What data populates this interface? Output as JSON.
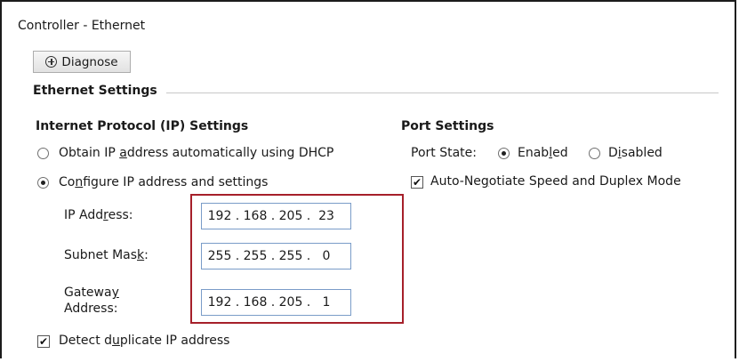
{
  "window": {
    "title": "Controller - Ethernet"
  },
  "toolbar": {
    "diagnose_label": "Diagnose"
  },
  "ethernet_settings": {
    "title": "Ethernet Settings",
    "ip_settings": {
      "title": "Internet Protocol (IP) Settings",
      "dhcp_option": {
        "label_pre": "Obtain IP ",
        "label_ul": "a",
        "label_post": "ddress automatically using DHCP",
        "checked": false
      },
      "manual_option": {
        "label_pre": "Co",
        "label_ul": "n",
        "label_post": "figure IP address and settings",
        "checked": true
      },
      "ip_address": {
        "label_pre": "IP Add",
        "label_ul": "r",
        "label_post": "ess:",
        "octets": [
          "192",
          "168",
          "205",
          "23"
        ]
      },
      "subnet_mask": {
        "label_pre": "Subnet Mas",
        "label_ul": "k",
        "label_post": ":",
        "octets": [
          "255",
          "255",
          "255",
          "0"
        ]
      },
      "gateway": {
        "label_line1_pre": "Gatewa",
        "label_line1_ul": "y",
        "label_line2": "Address:",
        "octets": [
          "192",
          "168",
          "205",
          "1"
        ]
      },
      "detect_duplicate": {
        "label_pre": "Detect d",
        "label_ul": "u",
        "label_post": "plicate IP address",
        "checked": true
      }
    },
    "port_settings": {
      "title": "Port Settings",
      "port_state_label": "Port State:",
      "enabled": {
        "label_pre": "Enab",
        "label_ul": "l",
        "label_post": "ed",
        "checked": true
      },
      "disabled": {
        "label_pre": "D",
        "label_ul": "i",
        "label_post": "sabled",
        "checked": false
      },
      "auto_negotiate": {
        "label_pre": "Auto-Ne",
        "label_ul": "g",
        "label_post": "otiate Speed and Duplex Mode",
        "checked": true
      }
    }
  },
  "colors": {
    "highlight_border": "#a6202a",
    "input_border": "#7a9cc8",
    "group_line": "#c8c8c8"
  },
  "icons": {
    "diagnose": "crosshair-circle-icon",
    "checkmark": "checkmark-icon"
  },
  "checkmark_glyph": "✔"
}
